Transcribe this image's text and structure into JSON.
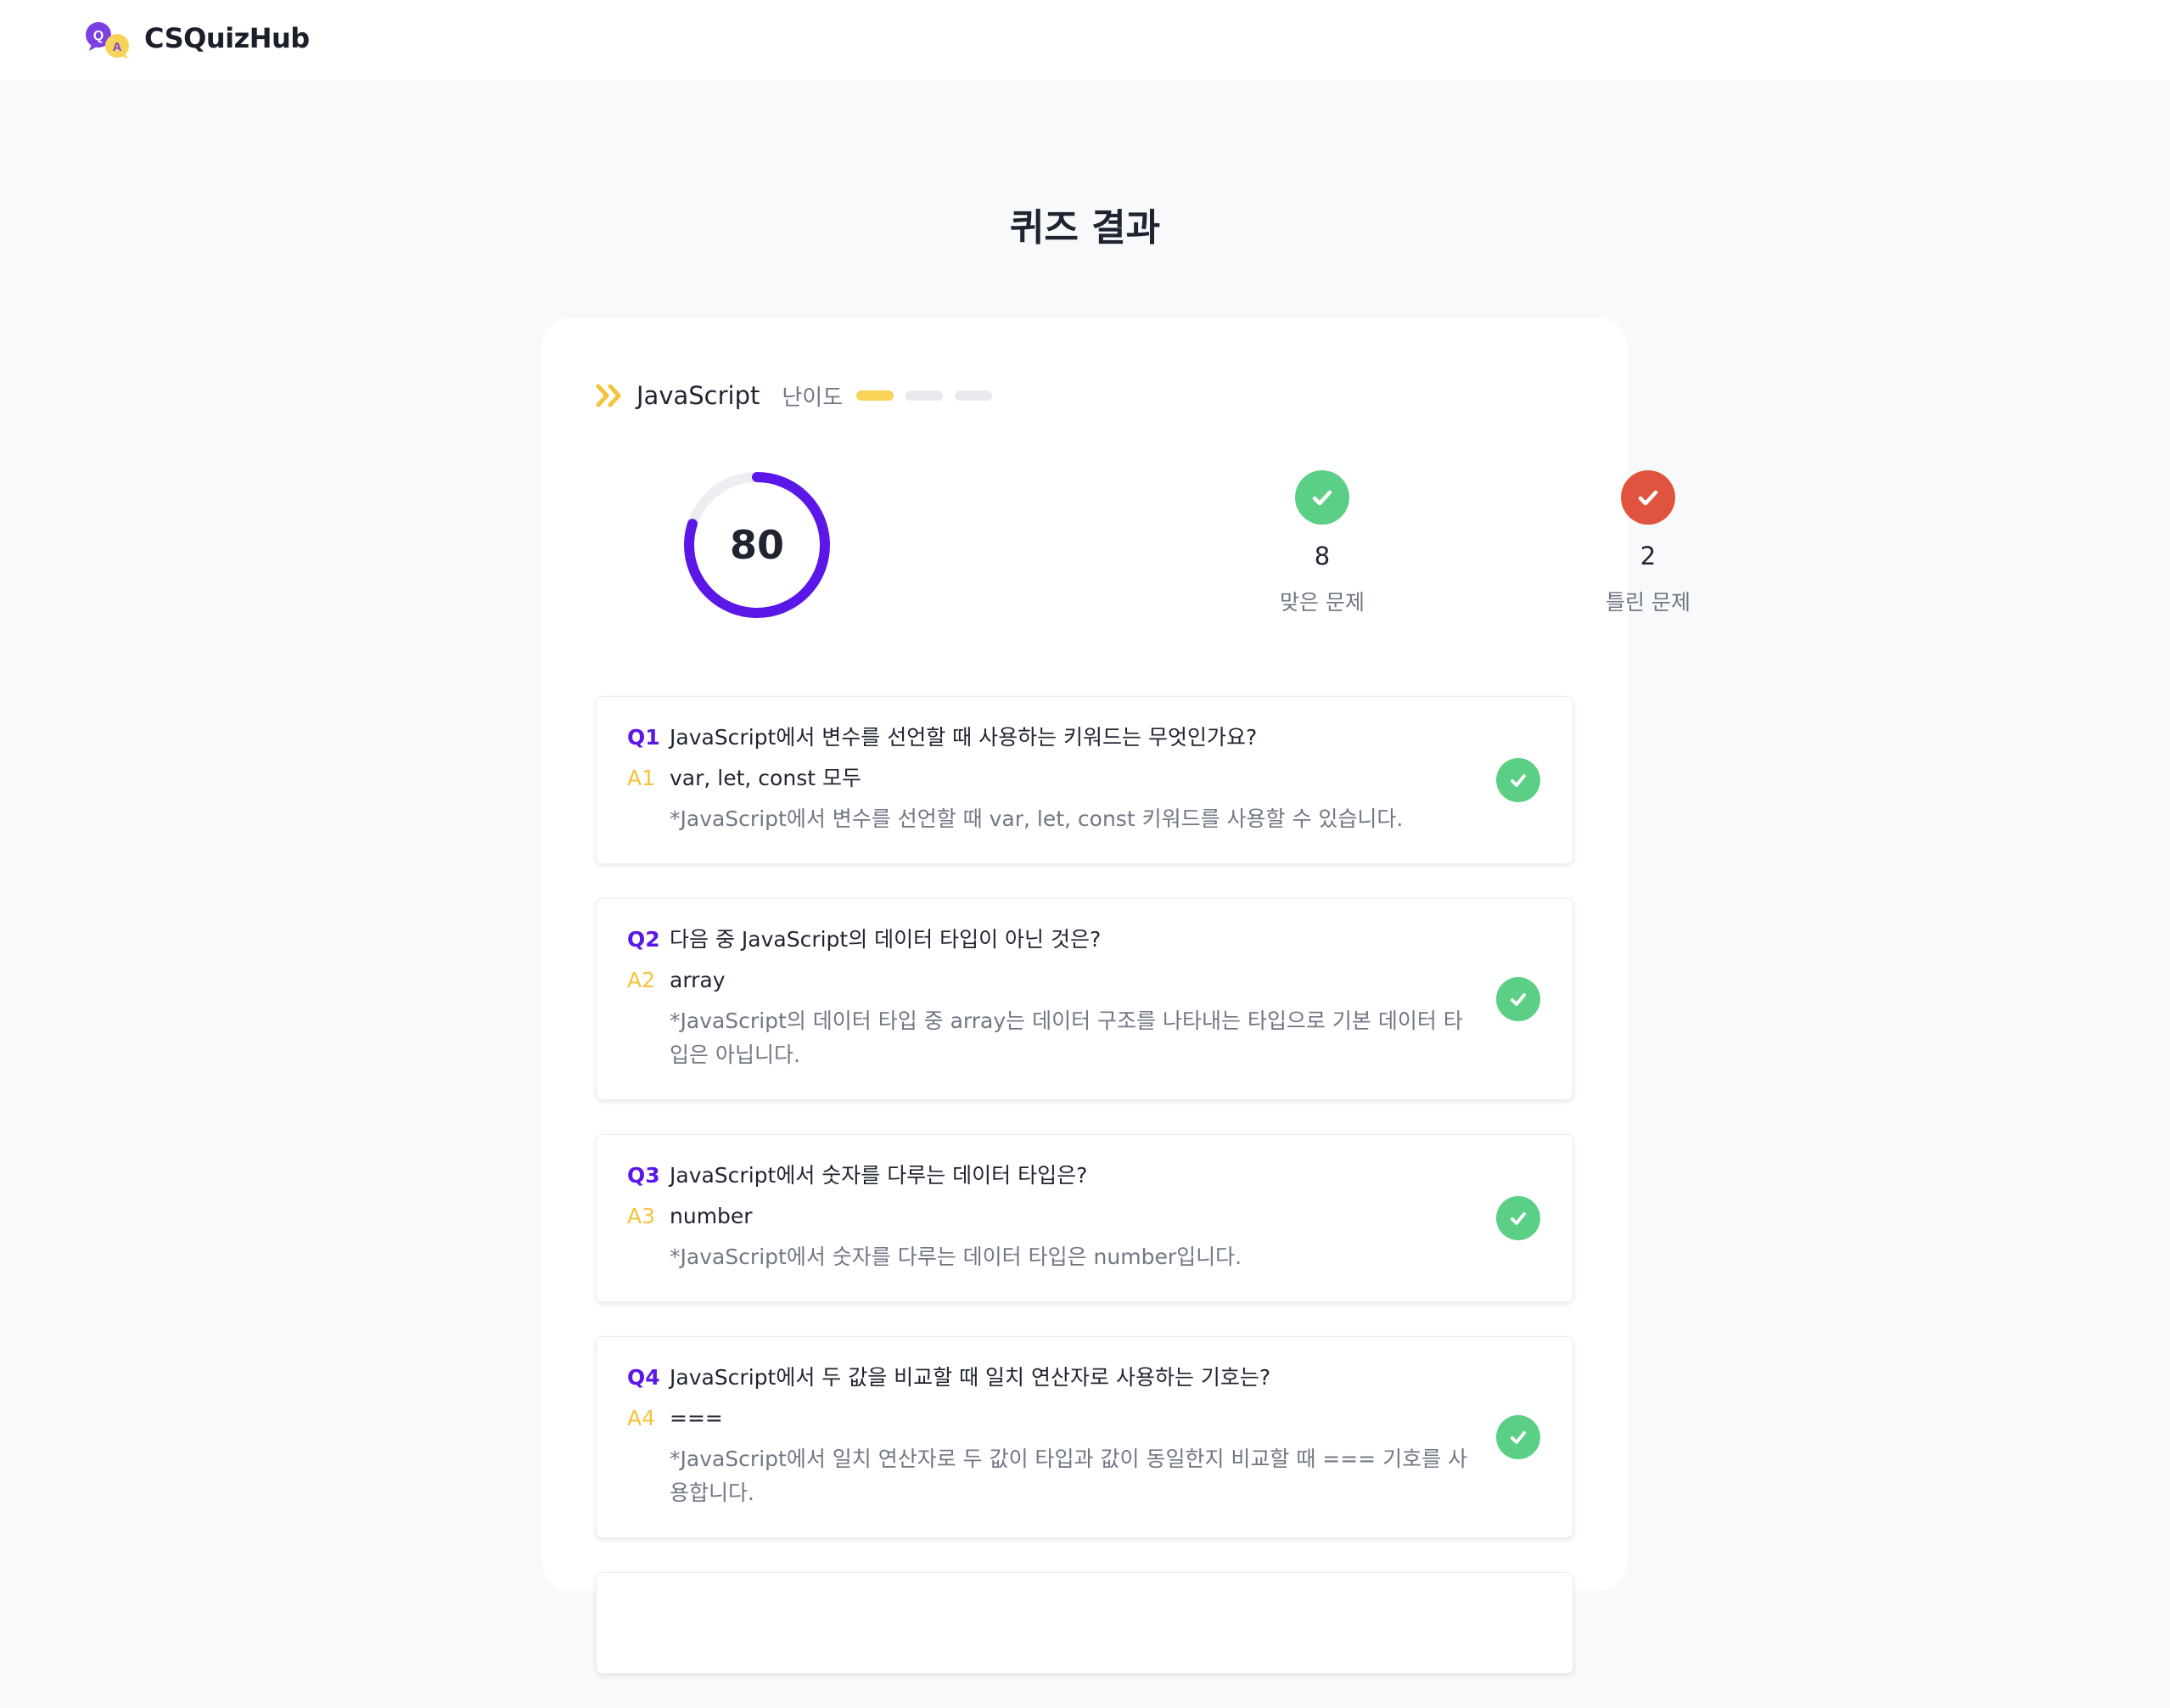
{
  "header": {
    "brand": "CSQuizHub",
    "logo_letters": {
      "q": "Q",
      "a": "A"
    }
  },
  "page": {
    "title": "퀴즈 결과"
  },
  "result": {
    "category": "JavaScript",
    "difficulty_label": "난이도",
    "difficulty_level": 1,
    "difficulty_max": 3,
    "score": "80",
    "score_fraction": 0.8,
    "correct_count": "8",
    "correct_label": "맞은 문제",
    "wrong_count": "2",
    "wrong_label": "틀린 문제"
  },
  "questions": [
    {
      "q_tag": "Q1",
      "question": "JavaScript에서 변수를 선언할 때 사용하는 키워드는 무엇인가요?",
      "a_tag": "A1",
      "answer": "var, let, const 모두",
      "explanation": "*JavaScript에서 변수를 선언할 때 var, let, const 키워드를 사용할 수 있습니다.",
      "status": "correct"
    },
    {
      "q_tag": "Q2",
      "question": "다음 중 JavaScript의 데이터 타입이 아닌 것은?",
      "a_tag": "A2",
      "answer": "array",
      "explanation": "*JavaScript의 데이터 타입 중 array는 데이터 구조를 나타내는 타입으로 기본 데이터 타입은 아닙니다.",
      "status": "correct"
    },
    {
      "q_tag": "Q3",
      "question": "JavaScript에서 숫자를 다루는 데이터 타입은?",
      "a_tag": "A3",
      "answer": "number",
      "explanation": "*JavaScript에서 숫자를 다루는 데이터 타입은 number입니다.",
      "status": "correct"
    },
    {
      "q_tag": "Q4",
      "question": "JavaScript에서 두 값을 비교할 때 일치 연산자로 사용하는 기호는?",
      "a_tag": "A4",
      "answer": "===",
      "explanation": "*JavaScript에서 일치 연산자로 두 값이 타입과 값이 동일한지 비교할 때 === 기호를 사용합니다.",
      "status": "correct"
    }
  ],
  "colors": {
    "accent_purple": "#5b16e8",
    "accent_yellow": "#f7d358",
    "correct_green": "#5ccf86",
    "wrong_red": "#e0533f",
    "ring_track": "#eceef2"
  },
  "icons": {
    "logo": "qa-chat-bubbles-icon",
    "category": "double-chevron-right-icon",
    "correct": "check-circle-icon",
    "wrong": "check-circle-icon"
  }
}
